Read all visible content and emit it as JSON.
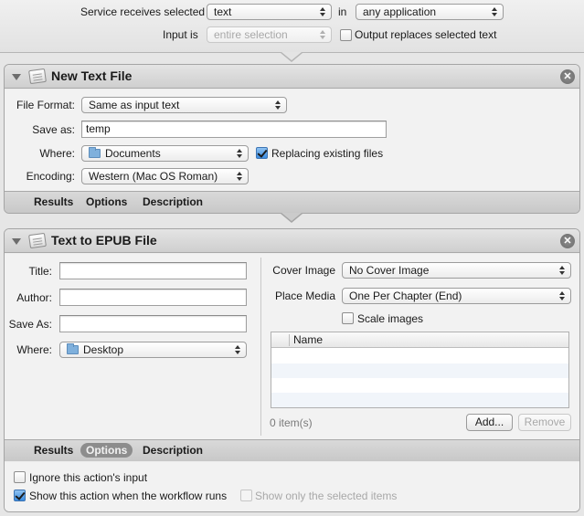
{
  "service": {
    "receives_label": "Service receives selected",
    "input_type": "text",
    "in_label": "in",
    "application": "any application",
    "input_is_label": "Input is",
    "input_is_value": "entire selection",
    "output_replaces_label": "Output replaces selected text",
    "output_replaces_checked": false
  },
  "new_text_file": {
    "title": "New Text File",
    "file_format_label": "File Format:",
    "file_format_value": "Same as input text",
    "save_as_label": "Save as:",
    "save_as_value": "temp",
    "where_label": "Where:",
    "where_value": "Documents",
    "replacing_label": "Replacing existing files",
    "replacing_checked": true,
    "encoding_label": "Encoding:",
    "encoding_value": "Western (Mac OS Roman)",
    "tabs": [
      "Results",
      "Options",
      "Description"
    ]
  },
  "text_to_epub": {
    "title": "Text to EPUB File",
    "title_label": "Title:",
    "title_value": "",
    "author_label": "Author:",
    "author_value": "",
    "save_as_label": "Save As:",
    "save_as_value": "",
    "where_label": "Where:",
    "where_value": "Desktop",
    "cover_image_label": "Cover Image",
    "cover_image_value": "No Cover Image",
    "place_media_label": "Place Media",
    "place_media_value": "One Per Chapter (End)",
    "scale_images_label": "Scale images",
    "scale_images_checked": false,
    "table_column_name": "Name",
    "item_count": "0 item(s)",
    "add_button": "Add...",
    "remove_button": "Remove",
    "tabs": [
      "Results",
      "Options",
      "Description"
    ],
    "active_tab": "Options",
    "ignore_input_label": "Ignore this action's input",
    "ignore_input_checked": false,
    "show_action_label": "Show this action when the workflow runs",
    "show_action_checked": true,
    "show_only_selected_label": "Show only the selected items",
    "show_only_selected_checked": false
  }
}
